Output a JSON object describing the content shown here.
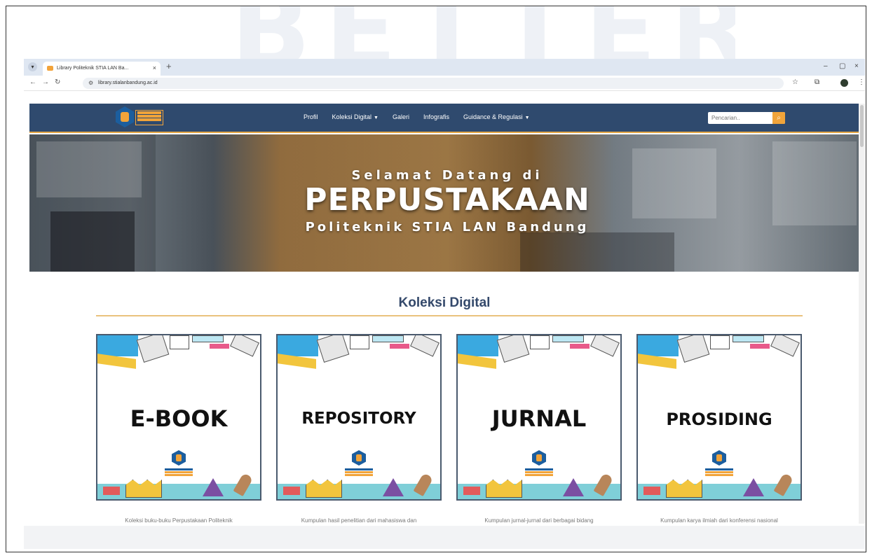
{
  "browser": {
    "tab_title": "Library Politeknik STIA LAN Ba...",
    "new_tab": "+",
    "tab_close": "×",
    "tab_menu": "▾",
    "url": "library.stialanbandung.ac.id",
    "win_min": "–",
    "win_restore": "▢",
    "win_close": "×"
  },
  "nav": {
    "links": [
      {
        "label": "Profil",
        "dropdown": false
      },
      {
        "label": "Koleksi Digital",
        "dropdown": true
      },
      {
        "label": "Galeri",
        "dropdown": false
      },
      {
        "label": "Infografis",
        "dropdown": false
      },
      {
        "label": "Guidance & Regulasi",
        "dropdown": true
      }
    ],
    "caret": "▼",
    "search_placeholder": "Pencarian..",
    "search_icon": "magnifier-icon"
  },
  "hero": {
    "line1": "Selamat Datang di",
    "line2": "PERPUSTAKAAN",
    "line3": "Politeknik STIA LAN Bandung"
  },
  "section": {
    "title": "Koleksi Digital"
  },
  "cards": [
    {
      "title": "E-BOOK",
      "desc": "Koleksi buku-buku Perpustakaan Politeknik"
    },
    {
      "title": "REPOSITORY",
      "desc": "Kumpulan hasil penelitian dari mahasiswa dan"
    },
    {
      "title": "JURNAL",
      "desc": "Kumpulan jurnal-jurnal dari berbagai bidang"
    },
    {
      "title": "PROSIDING",
      "desc": "Kumpulan karya ilmiah dari konferensi nasional"
    }
  ],
  "colors": {
    "nav_bg": "#2f4a6e",
    "accent": "#f1a43a",
    "section_title": "#34496b"
  }
}
